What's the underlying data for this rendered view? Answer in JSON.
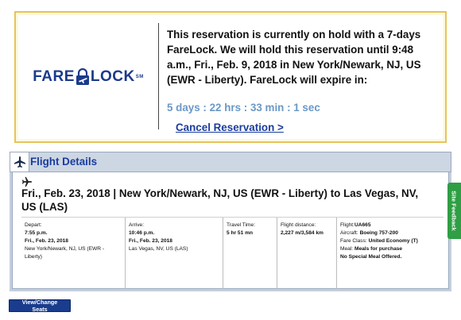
{
  "hold": {
    "logo_text_left": "FARE",
    "logo_text_right": "LOCK",
    "logo_tm": "SM",
    "message": "This reservation is currently on hold with a 7-days FareLock. We will hold this reservation until 9:48 a.m., Fri., Feb. 9, 2018 in New York/Newark, NJ, US (EWR - Liberty). FareLock will expire in:",
    "countdown": "5 days : 22 hrs : 33 min : 1 sec",
    "cancel_label": "Cancel Reservation >"
  },
  "flight_details": {
    "title": "Flight Details",
    "route": "Fri., Feb. 23, 2018 | New York/Newark, NJ, US (EWR - Liberty) to Las Vegas, NV, US (LAS)",
    "depart": {
      "label": "Depart:",
      "time": "7:55 p.m.",
      "date": "Fri., Feb. 23, 2018",
      "airport": "New York/Newark, NJ, US (EWR - Liberty)"
    },
    "arrive": {
      "label": "Arrive:",
      "time": "10:46 p.m.",
      "date": "Fri., Feb. 23, 2018",
      "airport": "Las Vegas, NV, US (LAS)"
    },
    "travel_time": {
      "label": "Travel Time:",
      "value": "5 hr 51 mn"
    },
    "distance": {
      "label": "Flight distance:",
      "value": "2,227 m/3,584 km"
    },
    "flight": {
      "flight_label": "Flight:",
      "flight_value": "UA665",
      "aircraft_label": "Aircraft:",
      "aircraft_value": "Boeing 757-200",
      "fare_label": "Fare Class:",
      "fare_value": "United Economy (T)",
      "meal_label": "Meal:",
      "meal_value": "Meals for purchase",
      "special_meal": "No Special Meal Offered."
    }
  },
  "feedback_tab": {
    "label": "Site Feedback"
  },
  "seats_button": {
    "label": "View/Change Seats"
  },
  "colors": {
    "brand_blue": "#1a3c9e",
    "hold_border": "#e7c35a",
    "countdown": "#6b98c7",
    "feedback_green": "#2f9e44",
    "header_bg": "#cdd6e3"
  },
  "icons": [
    "lock-icon",
    "airplane-icon",
    "feedback-icon"
  ]
}
